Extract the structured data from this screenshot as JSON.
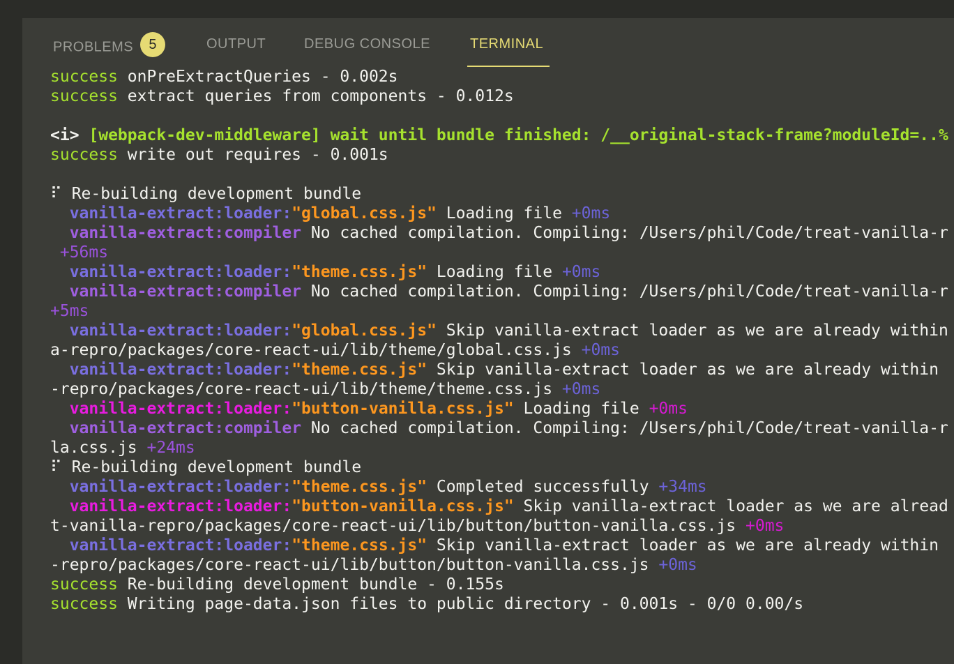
{
  "tabs": [
    {
      "label": "PROBLEMS",
      "badge": "5"
    },
    {
      "label": "OUTPUT"
    },
    {
      "label": "DEBUG CONSOLE"
    },
    {
      "label": "TERMINAL"
    }
  ],
  "lines": [
    [
      [
        "success",
        "green"
      ],
      [
        " onPreExtractQueries - 0.002s",
        "white"
      ]
    ],
    [
      [
        "success",
        "green"
      ],
      [
        " extract queries from components - 0.012s",
        "white"
      ]
    ],
    [],
    [
      [
        "<i> ",
        "white-bold"
      ],
      [
        "[webpack-dev-middleware] wait until bundle finished: /__original-stack-frame?moduleId=..%",
        "green-bold"
      ]
    ],
    [
      [
        "success",
        "green"
      ],
      [
        " write out requires - 0.001s",
        "white"
      ]
    ],
    [],
    [
      [
        "⠏ Re-building development bundle",
        "white"
      ]
    ],
    [
      [
        "  ",
        "white"
      ],
      [
        "vanilla-extract:loader:",
        "blue"
      ],
      [
        "\"global.css.js\"",
        "orange"
      ],
      [
        " Loading file ",
        "white"
      ],
      [
        "+0ms",
        "dblue"
      ]
    ],
    [
      [
        "  ",
        "white"
      ],
      [
        "vanilla-extract:compiler",
        "purple"
      ],
      [
        " No cached compilation. Compiling: /Users/phil/Code/treat-vanilla-r",
        "white"
      ]
    ],
    [
      [
        " +56ms",
        "dpurple"
      ]
    ],
    [
      [
        "  ",
        "white"
      ],
      [
        "vanilla-extract:loader:",
        "blue"
      ],
      [
        "\"theme.css.js\"",
        "orange"
      ],
      [
        " Loading file ",
        "white"
      ],
      [
        "+0ms",
        "dblue"
      ]
    ],
    [
      [
        "  ",
        "white"
      ],
      [
        "vanilla-extract:compiler",
        "purple"
      ],
      [
        " No cached compilation. Compiling: /Users/phil/Code/treat-vanilla-r",
        "white"
      ]
    ],
    [
      [
        "+5ms",
        "dpurple"
      ]
    ],
    [
      [
        "  ",
        "white"
      ],
      [
        "vanilla-extract:loader:",
        "blue"
      ],
      [
        "\"global.css.js\"",
        "orange"
      ],
      [
        " Skip vanilla-extract loader as we are already within",
        "white"
      ]
    ],
    [
      [
        "a-repro/packages/core-react-ui/lib/theme/global.css.js ",
        "white"
      ],
      [
        "+0ms",
        "dblue"
      ]
    ],
    [
      [
        "  ",
        "white"
      ],
      [
        "vanilla-extract:loader:",
        "blue"
      ],
      [
        "\"theme.css.js\"",
        "orange"
      ],
      [
        " Skip vanilla-extract loader as we are already within ",
        "white"
      ]
    ],
    [
      [
        "-repro/packages/core-react-ui/lib/theme/theme.css.js ",
        "white"
      ],
      [
        "+0ms",
        "dblue"
      ]
    ],
    [
      [
        "  ",
        "white"
      ],
      [
        "vanilla-extract:loader:",
        "magenta"
      ],
      [
        "\"button-vanilla.css.js\"",
        "orange"
      ],
      [
        " Loading file ",
        "white"
      ],
      [
        "+0ms",
        "dmagenta"
      ]
    ],
    [
      [
        "  ",
        "white"
      ],
      [
        "vanilla-extract:compiler",
        "purple"
      ],
      [
        " No cached compilation. Compiling: /Users/phil/Code/treat-vanilla-r",
        "white"
      ]
    ],
    [
      [
        "la.css.js ",
        "white"
      ],
      [
        "+24ms",
        "dpurple"
      ]
    ],
    [
      [
        "⠏ Re-building development bundle",
        "white"
      ]
    ],
    [
      [
        "  ",
        "white"
      ],
      [
        "vanilla-extract:loader:",
        "blue"
      ],
      [
        "\"theme.css.js\"",
        "orange"
      ],
      [
        " Completed successfully ",
        "white"
      ],
      [
        "+34ms",
        "dblue"
      ]
    ],
    [
      [
        "  ",
        "white"
      ],
      [
        "vanilla-extract:loader:",
        "magenta"
      ],
      [
        "\"button-vanilla.css.js\"",
        "orange"
      ],
      [
        " Skip vanilla-extract loader as we are alread",
        "white"
      ]
    ],
    [
      [
        "t-vanilla-repro/packages/core-react-ui/lib/button/button-vanilla.css.js ",
        "white"
      ],
      [
        "+0ms",
        "dmagenta"
      ]
    ],
    [
      [
        "  ",
        "white"
      ],
      [
        "vanilla-extract:loader:",
        "blue"
      ],
      [
        "\"theme.css.js\"",
        "orange"
      ],
      [
        " Skip vanilla-extract loader as we are already within ",
        "white"
      ]
    ],
    [
      [
        "-repro/packages/core-react-ui/lib/button/button-vanilla.css.js ",
        "white"
      ],
      [
        "+0ms",
        "dblue"
      ]
    ],
    [
      [
        "success",
        "green"
      ],
      [
        " Re-building development bundle - 0.155s",
        "white"
      ]
    ],
    [
      [
        "success",
        "green"
      ],
      [
        " Writing page-data.json files to public directory - 0.001s - 0/0 0.00/s",
        "white"
      ]
    ]
  ]
}
